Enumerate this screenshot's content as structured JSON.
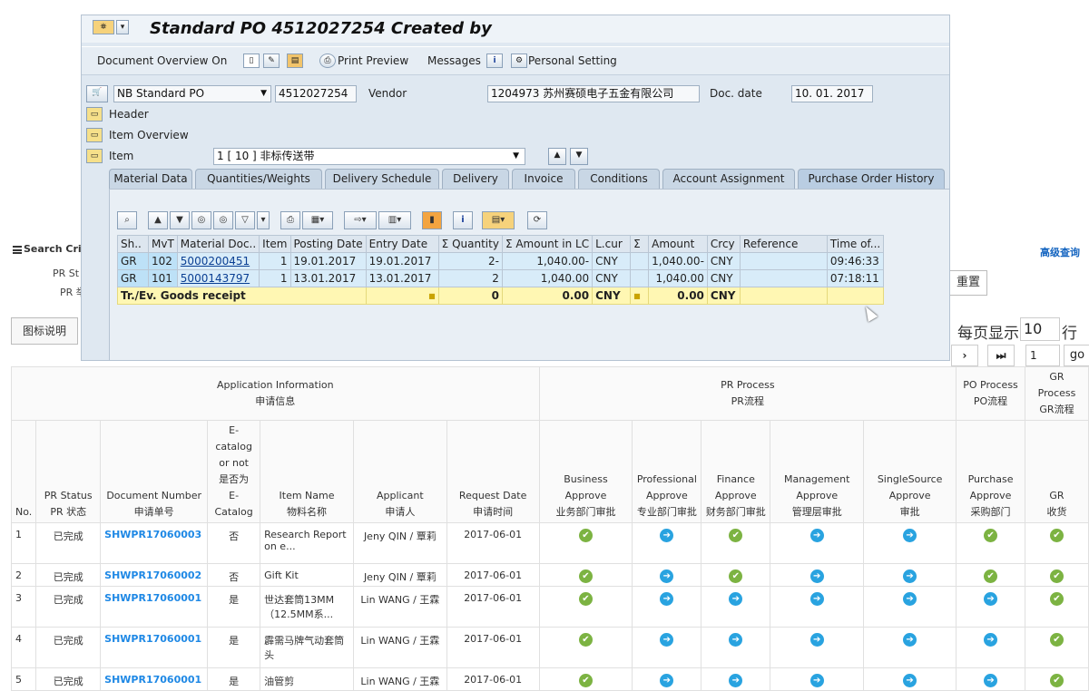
{
  "portal": {
    "search_criteria": "Search Crit",
    "crit_label_1": "PR St",
    "crit_label_2": "PR 举",
    "advanced_query": "高级查询",
    "legend_button": "图标说明",
    "reset_button": "重置",
    "per_page_label": "每页显示",
    "per_page_value": "10",
    "per_page_unit": "行",
    "next_btn": "›",
    "last_btn": "⏭",
    "page_value": "1",
    "go_btn": "go"
  },
  "grid": {
    "group_headers": {
      "app_info": "Application Information",
      "app_info_cn": "申请信息",
      "pr_process": "PR Process",
      "pr_process_cn": "PR流程",
      "po_process": "PO Process",
      "po_process_cn": "PO流程",
      "gr_process": "GR Process",
      "gr_process_cn": "GR流程"
    },
    "columns": {
      "no": "No.",
      "pr_status": "PR Status",
      "pr_status_cn": "PR 状态",
      "doc_num": "Document Number",
      "doc_num_cn": "申请单号",
      "ecat_1": "E-catalog",
      "ecat_2": "or not",
      "ecat_3": "是否为",
      "ecat_4": "E-Catalog",
      "item_name": "Item Name",
      "item_name_cn": "物料名称",
      "applicant": "Applicant",
      "applicant_cn": "申请人",
      "req_date": "Request Date",
      "req_date_cn": "申请时间",
      "biz_approve": "Business Approve",
      "biz_approve_cn": "业务部门审批",
      "prof_1": "Professional",
      "prof_2": "Approve",
      "prof_cn": "专业部门审批",
      "fin_1": "Finance",
      "fin_2": "Approve",
      "fin_cn": "财务部门审批",
      "mgmt_1": "Management",
      "mgmt_2": "Approve",
      "mgmt_cn": "管理层审批",
      "ss_1": "SingleSource",
      "ss_2": "Approve",
      "ss_cn": "审批",
      "pur_1": "Purchase",
      "pur_2": "Approve",
      "pur_cn": "采购部门",
      "gr": "GR",
      "gr_cn": "收货"
    },
    "rows": [
      {
        "no": "1",
        "status": "已完成",
        "doc": "SHWPR17060003",
        "ecat": "否",
        "item1": "Research Report",
        "item2": "on e...",
        "applicant": "Jeny QIN / 覃莉",
        "date": "2017-06-01"
      },
      {
        "no": "2",
        "status": "已完成",
        "doc": "SHWPR17060002",
        "ecat": "否",
        "item1": "Gift Kit",
        "item2": "",
        "applicant": "Jeny QIN / 覃莉",
        "date": "2017-06-01"
      },
      {
        "no": "3",
        "status": "已完成",
        "doc": "SHWPR17060001",
        "ecat": "是",
        "item1": "世达套筒13MM",
        "item2": "（12.5MM系...",
        "applicant": "Lin WANG / 王霖",
        "date": "2017-06-01"
      },
      {
        "no": "4",
        "status": "已完成",
        "doc": "SHWPR17060001",
        "ecat": "是",
        "item1": "霹需马牌气动套筒",
        "item2": "头",
        "applicant": "Lin WANG / 王霖",
        "date": "2017-06-01"
      },
      {
        "no": "5",
        "status": "已完成",
        "doc": "SHWPR17060001",
        "ecat": "是",
        "item1": "油管剪",
        "item2": "",
        "applicant": "Lin WANG / 王霖",
        "date": "2017-06-01"
      }
    ],
    "icons": {
      "ok_symbol": "✔",
      "go_symbol": "➔"
    }
  },
  "sap": {
    "title": "Standard PO 4512027254 Created by",
    "toolbar": {
      "doc_overview": "Document Overview On",
      "print_preview": "Print Preview",
      "messages": "Messages",
      "personal_setting": "Personal Setting"
    },
    "header": {
      "po_type": "NB Standard PO",
      "po_number": "4512027254",
      "vendor_label": "Vendor",
      "vendor_value": "1204973 苏州赛硕电子五金有限公司",
      "doc_date_label": "Doc. date",
      "doc_date_value": "10. 01. 2017"
    },
    "sections": {
      "header": "Header",
      "item_overview": "Item Overview",
      "item": "Item",
      "item_value": "1 [ 10 ] 非标传送带"
    },
    "tabs": [
      "Material Data",
      "Quantities/Weights",
      "Delivery Schedule",
      "Delivery",
      "Invoice",
      "Conditions",
      "Account Assignment",
      "Purchase Order History"
    ],
    "history": {
      "headers": [
        "Sh..",
        "MvT",
        "Material Doc..",
        "Item",
        "Posting Date",
        "Entry Date",
        "Σ Quantity",
        "Σ Amount in LC",
        "L.cur",
        "Σ",
        "Amount",
        "Crcy",
        "Reference",
        "Time of..."
      ],
      "rows": [
        [
          "GR",
          "102",
          "5000200451",
          "1",
          "19.01.2017",
          "19.01.2017",
          "2-",
          "1,040.00-",
          "CNY",
          "",
          "1,040.00-",
          "CNY",
          "",
          "09:46:33"
        ],
        [
          "GR",
          "101",
          "5000143797",
          "1",
          "13.01.2017",
          "13.01.2017",
          "2",
          "1,040.00",
          "CNY",
          "",
          "1,040.00",
          "CNY",
          "",
          "07:18:11"
        ]
      ],
      "total": {
        "label": "Tr./Ev. Goods receipt",
        "qty": "0",
        "amt_lc": "0.00",
        "lcur": "CNY",
        "amt": "0.00",
        "crcy": "CNY",
        "dot": "■"
      }
    }
  }
}
